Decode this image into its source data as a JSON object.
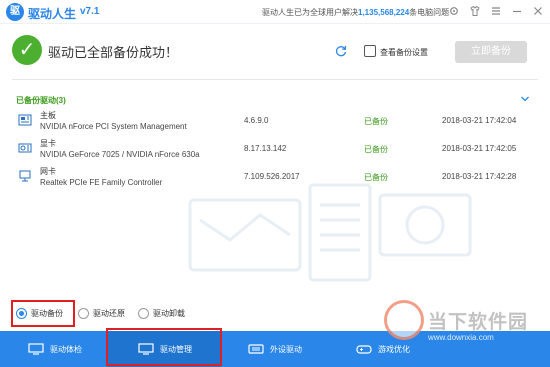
{
  "titlebar": {
    "logo_glyph": "驱",
    "app_name": "驱动人生",
    "version": "v7.1",
    "notice_prefix": "驱动人生已为全球用户解决",
    "notice_count": "1,135,568,224",
    "notice_suffix": "条电脑问题"
  },
  "header": {
    "success_glyph": "✓",
    "success_message": "驱动已全部备份成功！",
    "view_backup_label": "查看备份设置",
    "restore_button_label": "立即备份"
  },
  "group": {
    "title": "已备份驱动(3)"
  },
  "drivers": [
    {
      "category": "主板",
      "name": "NVIDIA nForce PCI System Management",
      "version": "4.6.9.0",
      "status": "已备份",
      "date": "2018-03-21 17:42:04"
    },
    {
      "category": "显卡",
      "name": "NVIDIA GeForce 7025 / NVIDIA nForce 630a",
      "version": "8.17.13.142",
      "status": "已备份",
      "date": "2018-03-21 17:42:05"
    },
    {
      "category": "网卡",
      "name": "Realtek PCIe FE Family Controller",
      "version": "7.109.526.2017",
      "status": "已备份",
      "date": "2018-03-21 17:42:28"
    }
  ],
  "radio_options": [
    {
      "label": "驱动备份",
      "selected": true
    },
    {
      "label": "驱动还原",
      "selected": false
    },
    {
      "label": "驱动卸载",
      "selected": false
    }
  ],
  "bottom_nav": [
    {
      "label": "驱动体检",
      "icon": "monitor-check-icon"
    },
    {
      "label": "驱动管理",
      "icon": "monitor-icon"
    },
    {
      "label": "外设驱动",
      "icon": "peripheral-icon"
    },
    {
      "label": "游戏优化",
      "icon": "game-icon"
    }
  ],
  "watermark": {
    "text": "当下软件园",
    "url": "www.downxia.com"
  },
  "colors": {
    "brand": "#2a86e8",
    "success": "#4caf2f",
    "status_green": "#3a9a1a",
    "highlight_red": "#e02020"
  }
}
